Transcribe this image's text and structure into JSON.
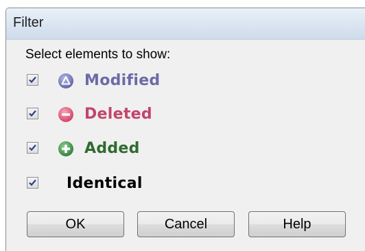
{
  "window": {
    "title": "Filter"
  },
  "prompt": "Select elements to show:",
  "options": [
    {
      "label": "Modified",
      "checked": true,
      "color": "#6b6ba8",
      "icon": "modified-icon"
    },
    {
      "label": "Deleted",
      "checked": true,
      "color": "#c2456b",
      "icon": "deleted-icon"
    },
    {
      "label": "Added",
      "checked": true,
      "color": "#2f6b2f",
      "icon": "added-icon"
    },
    {
      "label": "Identical",
      "checked": true,
      "color": "#000000",
      "icon": ""
    }
  ],
  "buttons": {
    "ok": "OK",
    "cancel": "Cancel",
    "help": "Help"
  }
}
